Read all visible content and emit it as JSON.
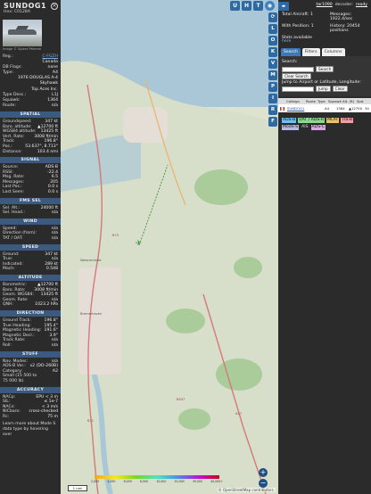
{
  "sidebar": {
    "callsign": "SUNDOG1",
    "hex_line": "Hex: C0128A",
    "close_icon": "close-icon",
    "photo_caption": "Image © Sjoerd Peterse",
    "reg": {
      "label": "Reg.:",
      "value": "C-FGZH"
    },
    "country": "Canada",
    "db_flags": {
      "label": "DB Flags:",
      "value": "none"
    },
    "type": {
      "label": "Type:",
      "value": "A4"
    },
    "type_desc_1": "1976 DOUGLAS A-4",
    "type_desc_2": "Skyhawk",
    "operator": "Top Aces Inc.",
    "type_desc": {
      "label": "Type Desc.:",
      "value": "L1J"
    },
    "squawk": {
      "label": "Squawk:",
      "value": "1364"
    },
    "route": {
      "label": "Route:",
      "value": "n/a"
    },
    "sections": {
      "spatial": "SPATIAL",
      "signal": "SIGNAL",
      "fms_sel": "FMS SEL",
      "wind": "WIND",
      "speed": "SPEED",
      "altitude": "ALTITUDE",
      "direction": "DIRECTION",
      "stuff": "STUFF",
      "accuracy": "ACCURACY"
    },
    "spatial": [
      {
        "k": "Groundspeed:",
        "v": "347 kt"
      },
      {
        "k": "Baro. altitude:",
        "v": "▲12700 ft"
      },
      {
        "k": "WGS84 altitude:",
        "v": "13425 ft"
      },
      {
        "k": "Vert. Rate:",
        "v": "3008 ft/min"
      },
      {
        "k": "Track:",
        "v": "196.8°"
      },
      {
        "k": "Pos.:",
        "v": "53.637°, 8.713°"
      },
      {
        "k": "Distance:",
        "v": "103.4 nmi"
      }
    ],
    "signal": [
      {
        "k": "Source:",
        "v": "ADS-B"
      },
      {
        "k": "RSSI:",
        "v": "-22.4"
      },
      {
        "k": "Msg. Rate:",
        "v": "6.5"
      },
      {
        "k": "Messages:",
        "v": "205"
      },
      {
        "k": "Last Pos.:",
        "v": "0.0 s"
      },
      {
        "k": "Last Seen:",
        "v": "0.0 s"
      }
    ],
    "fms": [
      {
        "k": "Sel. Alt.:",
        "v": "24000 ft"
      },
      {
        "k": "Sel. Head.:",
        "v": "n/a"
      }
    ],
    "wind": [
      {
        "k": "Speed:",
        "v": "n/a"
      },
      {
        "k": "Direction (from):",
        "v": "n/a"
      },
      {
        "k": "TAT / OAT:",
        "v": "n/a"
      }
    ],
    "speed": [
      {
        "k": "Ground:",
        "v": "347 kt"
      },
      {
        "k": "True:",
        "v": "n/a"
      },
      {
        "k": "Indicated:",
        "v": "289 kt"
      },
      {
        "k": "Mach:",
        "v": "0.548"
      }
    ],
    "altitude": [
      {
        "k": "Barometric:",
        "v": "▲12700 ft"
      },
      {
        "k": "Baro. Rate:",
        "v": "3008 ft/min"
      },
      {
        "k": "Geom. WGS84:",
        "v": "13425 ft"
      },
      {
        "k": "Geom. Rate:",
        "v": "n/a"
      },
      {
        "k": "QNH:",
        "v": "1023.2 hPa"
      }
    ],
    "direction": [
      {
        "k": "Ground Track:",
        "v": "196.8°"
      },
      {
        "k": "True Heading:",
        "v": "195.4°"
      },
      {
        "k": "Magnetic Heading:",
        "v": "191.6°"
      },
      {
        "k": "Magnetic Decl.:",
        "v": "3.9°"
      },
      {
        "k": "Track Rate:",
        "v": "n/a"
      },
      {
        "k": "Roll:",
        "v": "n/a"
      }
    ],
    "stuff": [
      {
        "k": "Nav. Modes:",
        "v": "n/a"
      },
      {
        "k": "ADS-B Ver.:",
        "v": "v2 (DO-260B)"
      },
      {
        "k": "Category:",
        "v": "A2"
      }
    ],
    "category_desc_1": "Small (15 500 to",
    "category_desc_2": "75 000 lb)",
    "accuracy": [
      {
        "k": "NACp:",
        "v": "EPU < 3 m"
      },
      {
        "k": "SIL:",
        "v": "≤ 1e-7"
      },
      {
        "k": "NACv:",
        "v": "< 3 m/s"
      },
      {
        "k": "NICbaro:",
        "v": "cross-checked"
      },
      {
        "k": "Rc:",
        "v": "75 m"
      }
    ],
    "learn_more_1": "Learn more about Mode S",
    "learn_more_2": "data type by hovering over"
  },
  "map": {
    "top_buttons": [
      "U",
      "H",
      "T"
    ],
    "circle_button": "◉",
    "side_buttons": [
      "⟳",
      "L",
      "O",
      "K",
      "V",
      "M",
      "P",
      "I",
      "R",
      "F"
    ],
    "zoom_in": "+",
    "zoom_out": "−",
    "scale_label": "1 nmi",
    "altitude_labels": [
      "2,000",
      "4,000",
      "6,000",
      "8,000",
      "10,000",
      "20,000",
      "30,000",
      "40,000+"
    ],
    "attribution": "© OpenStreetMap contributors.",
    "labels": [
      "B73",
      "Wesermünde",
      "Bremerhaven",
      "B71",
      "B437",
      "A27"
    ]
  },
  "right": {
    "version": "tar1090",
    "decoder": "decoder:",
    "ready": "ready",
    "stats": [
      {
        "k": "Total Aircraft:",
        "v": "1"
      },
      {
        "k": "Messages:",
        "v": "1922.4/sec"
      },
      {
        "k": "With Position:",
        "v": "1"
      },
      {
        "k": "History:",
        "v": "20454 positions"
      }
    ],
    "stats_available": "Stats available",
    "stats_link": "here",
    "tabs": [
      "Search",
      "Filters",
      "Columns"
    ],
    "search_label": "Search:",
    "search_button": "Search",
    "clear_search": "Clear Search",
    "jump_label": "Jump to Airport or Latitude, Longitude:",
    "jump_button": "Jump",
    "clear_button": "Clear",
    "table_headers": [
      "",
      "Callsign",
      "Route",
      "Type",
      "Squawk",
      "Alt. (ft)",
      "Spd."
    ],
    "row": {
      "callsign": "SUNDOG1",
      "type": "A4",
      "squawk": "1364",
      "alt": "▲12700",
      "spd": "34"
    },
    "legend": [
      {
        "label": "ADS-B",
        "color": "#6ec0f0"
      },
      {
        "label": "UAT / ADS-R",
        "color": "#8fd68f"
      },
      {
        "label": "MLAT",
        "color": "#e8c36a"
      },
      {
        "label": "TIS-B",
        "color": "#f09ea0"
      },
      {
        "label": "Mode-S",
        "color": "#b8b8e8"
      },
      {
        "label": "AIS",
        "color": "#2b2b2b"
      },
      {
        "label": "ADS-C",
        "color": "#d8a8e0"
      }
    ]
  }
}
